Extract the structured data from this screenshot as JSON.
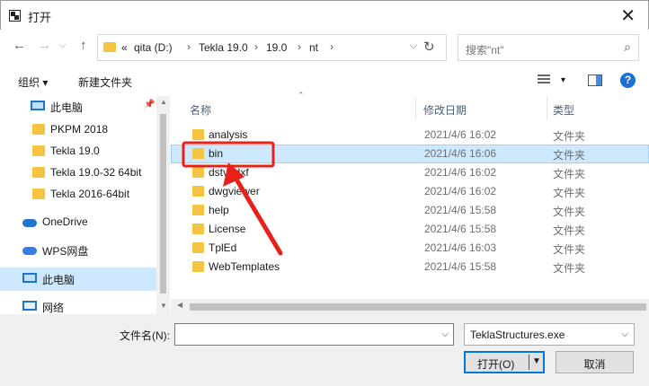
{
  "window": {
    "title": "打开",
    "close_glyph": "✕"
  },
  "nav": {
    "back_glyph": "←",
    "forward_glyph": "→",
    "forward_dd_glyph": "⌵",
    "up_glyph": "↑",
    "breadcrumbs": {
      "overflow": "«",
      "drive": "qita (D:)",
      "tekla": "Tekla 19.0",
      "version": "19.0",
      "nt": "nt"
    },
    "sep_glyph": "›",
    "addr_dd_glyph": "⌵",
    "refresh_glyph": "↻",
    "search_placeholder": "搜索\"nt\"",
    "search_glyph": "⌕"
  },
  "toolbar": {
    "organize_label": "组织 ▾",
    "new_folder_label": "新建文件夹",
    "view_dd_glyph": "▾",
    "help_glyph": "?"
  },
  "sidebar": {
    "pin_glyph": "📌",
    "items": [
      {
        "label": "此电脑",
        "icon": "pc-icon"
      },
      {
        "label": "PKPM 2018",
        "icon": "folder-icon"
      },
      {
        "label": "Tekla 19.0",
        "icon": "folder-icon"
      },
      {
        "label": "Tekla 19.0-32 64bit",
        "icon": "folder-icon"
      },
      {
        "label": "Tekla 2016-64bit",
        "icon": "folder-icon"
      },
      {
        "label": "OneDrive",
        "icon": "cloud-icon"
      },
      {
        "label": "WPS网盘",
        "icon": "cloud-icon"
      },
      {
        "label": "此电脑",
        "icon": "pc-icon",
        "selected": true
      },
      {
        "label": "网络",
        "icon": "network-icon"
      }
    ]
  },
  "filelist": {
    "columns": {
      "name": "名称",
      "date": "修改日期",
      "type": "类型"
    },
    "sort_glyph": "⌃",
    "rows": [
      {
        "name": "analysis",
        "date": "2021/4/6 16:02",
        "type": "文件夹"
      },
      {
        "name": "bin",
        "date": "2021/4/6 16:06",
        "type": "文件夹",
        "selected": true
      },
      {
        "name": "dstv2dxf",
        "date": "2021/4/6 16:02",
        "type": "文件夹"
      },
      {
        "name": "dwgviewer",
        "date": "2021/4/6 16:02",
        "type": "文件夹"
      },
      {
        "name": "help",
        "date": "2021/4/6 15:58",
        "type": "文件夹"
      },
      {
        "name": "License",
        "date": "2021/4/6 15:58",
        "type": "文件夹"
      },
      {
        "name": "TplEd",
        "date": "2021/4/6 16:03",
        "type": "文件夹"
      },
      {
        "name": "WebTemplates",
        "date": "2021/4/6 15:58",
        "type": "文件夹"
      }
    ]
  },
  "scroll": {
    "up": "▲",
    "down": "▼",
    "left": "◀"
  },
  "bottom": {
    "filename_label": "文件名(N):",
    "filename_value": "",
    "dd_glyph": "⌵",
    "filetype_value": "TeklaStructures.exe",
    "open_label": "打开(O)",
    "open_dd_glyph": "▼",
    "cancel_label": "取消"
  },
  "colors": {
    "accent": "#0078d7",
    "selection": "#cde8ff",
    "folder": "#f5c542",
    "annotation": "#e8201a"
  }
}
